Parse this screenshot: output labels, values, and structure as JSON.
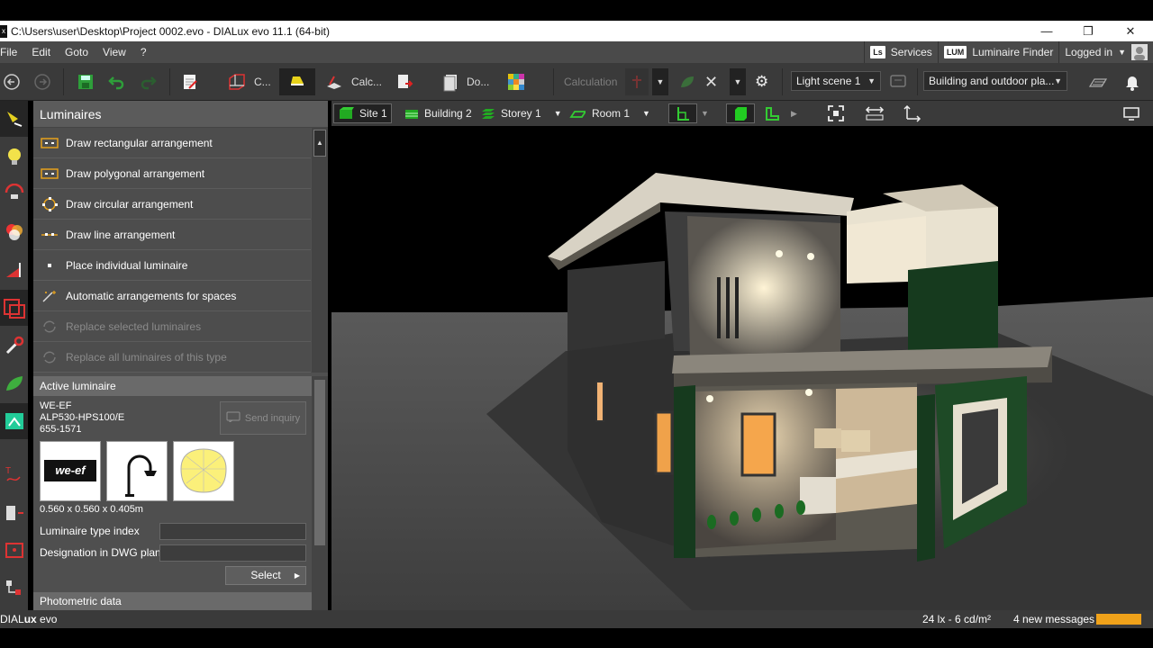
{
  "window": {
    "title": "C:\\Users\\user\\Desktop\\Project 0002.evo - DIALux evo 11.1  (64-bit)",
    "minimize": "—",
    "maximize": "❐",
    "close": "✕"
  },
  "menubar": {
    "items": [
      "File",
      "Edit",
      "Goto",
      "View",
      "?"
    ],
    "services": "Services",
    "services_badge": "Ls",
    "luminaire_finder": "Luminaire Finder",
    "luminaire_finder_badge": "LUM",
    "logged_in": "Logged in"
  },
  "toolbar": {
    "construction_label": "C...",
    "calculation_objects_label": "Calc...",
    "documentation_label": "Do...",
    "calculation_label": "Calculation",
    "light_scene": "Light scene 1",
    "view_select": "Building and outdoor pla..."
  },
  "panel": {
    "title": "Luminaires",
    "arrangements": [
      {
        "label": "Draw rectangular arrangement",
        "enabled": true
      },
      {
        "label": "Draw polygonal arrangement",
        "enabled": true
      },
      {
        "label": "Draw circular arrangement",
        "enabled": true
      },
      {
        "label": "Draw line arrangement",
        "enabled": true
      },
      {
        "label": "Place individual luminaire",
        "enabled": true
      },
      {
        "label": "Automatic arrangements for spaces",
        "enabled": true
      },
      {
        "label": "Replace selected luminaires",
        "enabled": false
      },
      {
        "label": "Replace all luminaires of this type",
        "enabled": false
      }
    ],
    "active_luminaire": {
      "header": "Active luminaire",
      "manufacturer": "WE-EF",
      "model": "ALP530-HPS100/E",
      "article": "655-1571",
      "brand_logo": "we-ef",
      "send_inquiry": "Send inquiry",
      "dimensions": "0.560 x 0.560 x 0.405m",
      "type_index_label": "Luminaire type index",
      "type_index_value": "",
      "dwg_label": "Designation in DWG plan",
      "dwg_value": "",
      "select_label": "Select"
    },
    "photometric_header": "Photometric data"
  },
  "viewbar": {
    "site": "Site 1",
    "building": "Building 2",
    "storey": "Storey 1",
    "room": "Room 1"
  },
  "status": {
    "logo_prefix": "DIAL",
    "logo_mid": "ux",
    "logo_suffix": " evo",
    "lux": "24 lx - 6 cd/m²",
    "messages": "4 new messages",
    "accent": "#f0a21a"
  }
}
